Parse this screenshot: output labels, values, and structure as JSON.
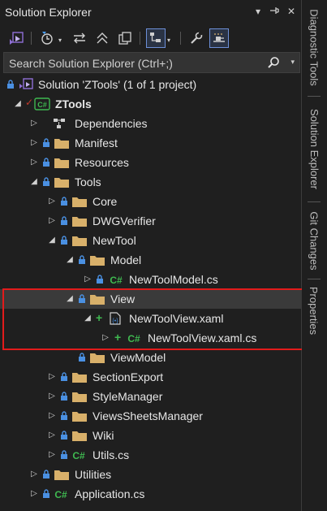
{
  "panel": {
    "title": "Solution Explorer",
    "title_buttons": {
      "dropdown": "▾",
      "pin": "⊣",
      "close": "✕"
    }
  },
  "search": {
    "placeholder": "Search Solution Explorer (Ctrl+;)"
  },
  "tree": {
    "solution": "Solution 'ZTools' (1 of 1 project)",
    "project": "ZTools",
    "items": {
      "dependencies": "Dependencies",
      "manifest": "Manifest",
      "resources": "Resources",
      "tools": "Tools",
      "core": "Core",
      "dwgverifier": "DWGVerifier",
      "newtool": "NewTool",
      "model": "Model",
      "newtoolmodel": "NewToolModel.cs",
      "view": "View",
      "newtoolview_xaml": "NewToolView.xaml",
      "newtoolview_xaml_cs": "NewToolView.xaml.cs",
      "viewmodel": "ViewModel",
      "sectionexport": "SectionExport",
      "stylemanager": "StyleManager",
      "viewssheetsmanager": "ViewsSheetsManager",
      "wiki": "Wiki",
      "utils": "Utils.cs",
      "utilities": "Utilities",
      "application": "Application.cs"
    }
  },
  "side_tabs": [
    "Diagnostic Tools",
    "Solution Explorer",
    "Git Changes",
    "Properties"
  ],
  "colors": {
    "background": "#1f1f1f",
    "highlight_border": "#e21b1b",
    "folder": "#d8b06a",
    "csharp": "#3fb950",
    "solution": "#8f6fd6",
    "selection": "#3a3a3a"
  }
}
